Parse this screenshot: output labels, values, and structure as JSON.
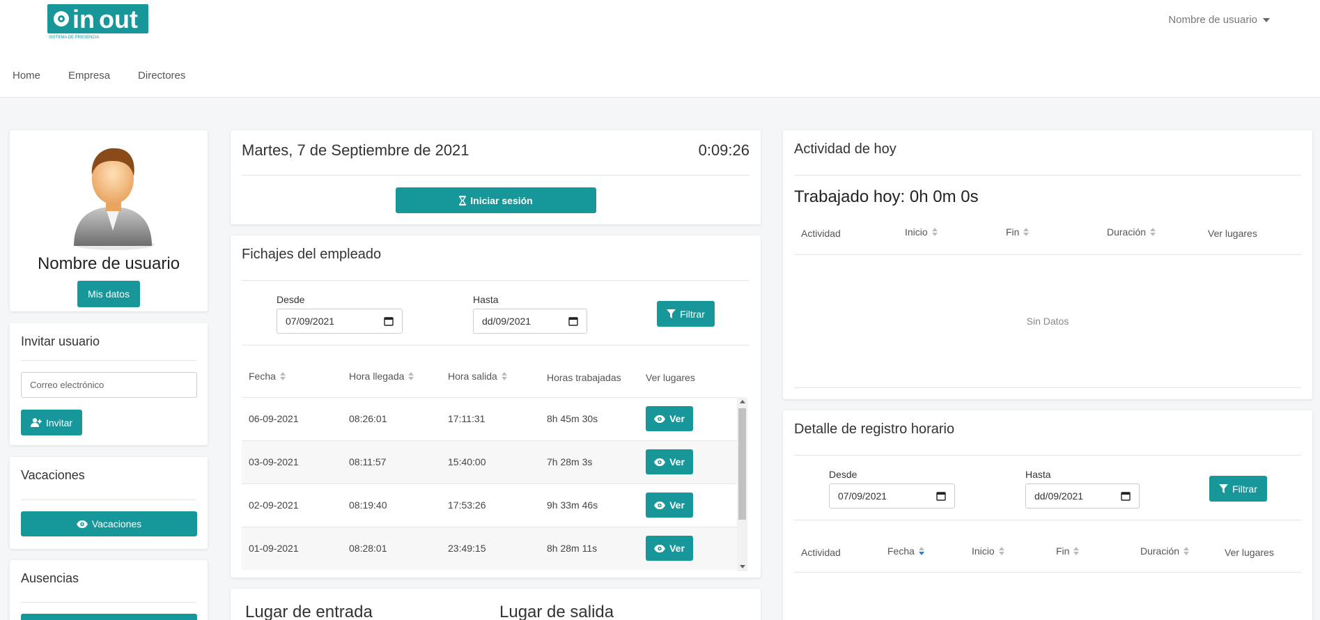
{
  "header": {
    "logo_text": "inout",
    "logo_subtitle": "SISTEMA DE PRESENCIA",
    "user_menu": "Nombre de usuario",
    "nav": [
      "Home",
      "Empresa",
      "Directores"
    ]
  },
  "profile": {
    "name": "Nombre de usuario",
    "button": "Mis datos"
  },
  "invite": {
    "title": "Invitar usuario",
    "email_placeholder": "Correo electrónico",
    "button": "Invitar"
  },
  "vacations": {
    "title": "Vacaciones",
    "button": "Vacaciones"
  },
  "absences": {
    "title": "Ausencias"
  },
  "session": {
    "date": "Martes, 7 de Septiembre de 2021",
    "time": "0:09:26",
    "button": "Iniciar sesión"
  },
  "checkins": {
    "title": "Fichajes del empleado",
    "from_label": "Desde",
    "from_value": "07/09/2021",
    "to_label": "Hasta",
    "to_value": "dd/09/2021",
    "filter_button": "Filtrar",
    "columns": [
      "Fecha",
      "Hora llegada",
      "Hora salida",
      "Horas trabajadas",
      "Ver lugares"
    ],
    "rows": [
      {
        "fecha": "06-09-2021",
        "llegada": "08:26:01",
        "salida": "17:11:31",
        "horas": "8h 45m 30s",
        "ver": "Ver"
      },
      {
        "fecha": "03-09-2021",
        "llegada": "08:11:57",
        "salida": "15:40:00",
        "horas": "7h 28m 3s",
        "ver": "Ver"
      },
      {
        "fecha": "02-09-2021",
        "llegada": "08:19:40",
        "salida": "17:53:26",
        "horas": "9h 33m 46s",
        "ver": "Ver"
      },
      {
        "fecha": "01-09-2021",
        "llegada": "08:28:01",
        "salida": "23:49:15",
        "horas": "8h 28m 11s",
        "ver": "Ver"
      }
    ]
  },
  "places": {
    "entry_title": "Lugar de entrada",
    "exit_title": "Lugar de salida"
  },
  "today": {
    "title": "Actividad de hoy",
    "worked": "Trabajado hoy: 0h 0m 0s",
    "columns": [
      "Actividad",
      "Inicio",
      "Fin",
      "Duración",
      "Ver lugares"
    ],
    "empty": "Sin Datos"
  },
  "detail": {
    "title": "Detalle de registro horario",
    "from_label": "Desde",
    "from_value": "07/09/2021",
    "to_label": "Hasta",
    "to_value": "dd/09/2021",
    "filter_button": "Filtrar",
    "columns": [
      "Actividad",
      "Fecha",
      "Inicio",
      "Fin",
      "Duración",
      "Ver lugares"
    ]
  },
  "colors": {
    "accent": "#17979a",
    "background": "#f4f6f9",
    "sort_active": "#2a7bd6"
  }
}
